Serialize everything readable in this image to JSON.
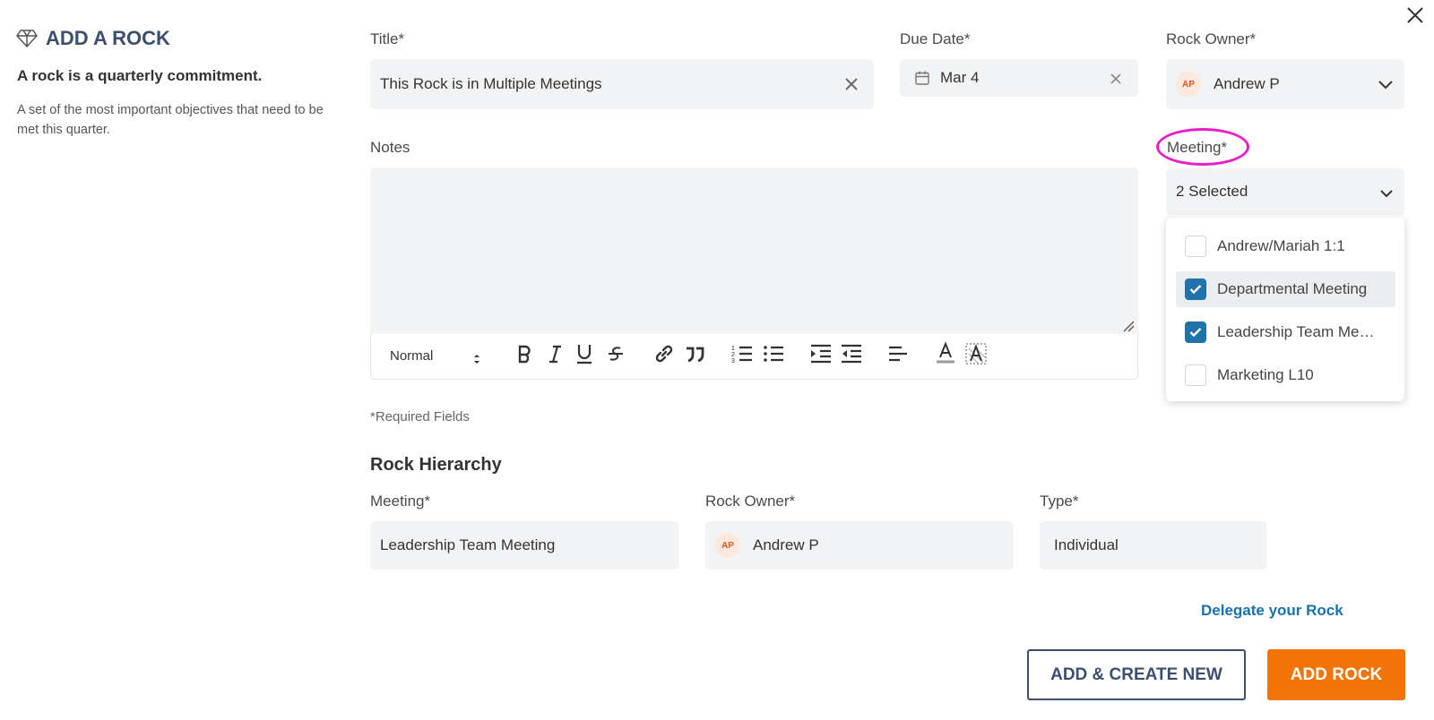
{
  "panel": {
    "title": "ADD A ROCK",
    "subtitle": "A rock is a quarterly commitment.",
    "description": "A set of the most important objectives that need to be met this quarter."
  },
  "form": {
    "title_label": "Title*",
    "title_value": "This Rock is in Multiple Meetings",
    "due_label": "Due Date*",
    "due_value": "Mar 4",
    "owner_label": "Rock Owner*",
    "owner_initials": "AP",
    "owner_name": "Andrew P",
    "notes_label": "Notes",
    "meeting_label": "Meeting*",
    "meeting_value": "2 Selected",
    "required_note": "*Required Fields"
  },
  "editor_toolbar": {
    "format_select": "Normal",
    "buttons": [
      "bold",
      "italic",
      "underline",
      "strikethrough",
      "link",
      "quote",
      "ordered-list",
      "bullet-list",
      "indent",
      "outdent",
      "align",
      "text-color",
      "background-color"
    ]
  },
  "meeting_dropdown": {
    "options": [
      {
        "label": "Andrew/Mariah 1:1",
        "checked": false
      },
      {
        "label": "Departmental Meeting",
        "checked": true
      },
      {
        "label": "Leadership Team Meeting",
        "checked": true
      },
      {
        "label": "Marketing L10",
        "checked": false
      }
    ]
  },
  "hierarchy": {
    "heading": "Rock Hierarchy",
    "meeting_label": "Meeting*",
    "meeting_value": "Leadership Team Meeting",
    "owner_label": "Rock Owner*",
    "owner_initials": "AP",
    "owner_name": "Andrew P",
    "type_label": "Type*",
    "type_value": "Individual"
  },
  "actions": {
    "delegate_link": "Delegate your Rock",
    "add_create_new": "ADD & CREATE NEW",
    "add_rock": "ADD ROCK"
  },
  "colors": {
    "accent_orange": "#f07407",
    "checkbox_blue": "#1f73a8",
    "link_blue": "#1a73a8",
    "highlight_magenta": "#e91ec9",
    "title_navy": "#3d4f6e"
  }
}
